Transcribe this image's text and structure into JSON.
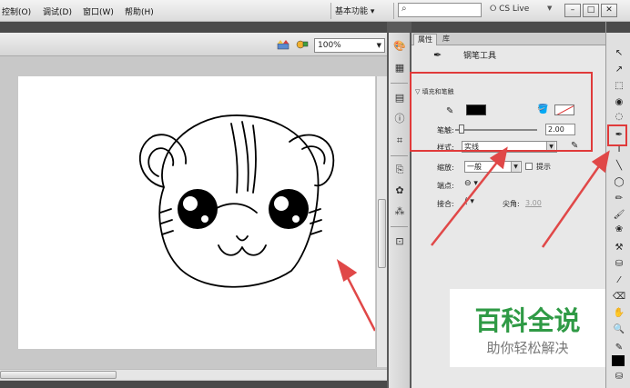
{
  "menubar": {
    "items": [
      "控制(O)",
      "调试(D)",
      "窗口(W)",
      "帮助(H)"
    ],
    "workspace": "基本功能",
    "search_placeholder": "",
    "cslive": "CS Live"
  },
  "stage": {
    "zoom": "100%"
  },
  "properties": {
    "tab_properties": "属性",
    "tab_library": "库",
    "tool_name": "钢笔工具",
    "section_fill_stroke": "填充和笔触",
    "stroke_width_label": "笔触:",
    "stroke_width_value": "2.00",
    "style_label": "样式:",
    "style_value": "实线",
    "scale_label": "缩放:",
    "scale_value": "一般",
    "hint_label": "提示",
    "cap_label": "端点:",
    "join_label": "接合:",
    "miter_label": "尖角:",
    "miter_value": "3.00",
    "colors": {
      "stroke": "#000000",
      "fill": "#ffffff",
      "highlight": "#e03a3a"
    }
  },
  "watermark": {
    "title": "百科全说",
    "subtitle": "助你轻松解决"
  },
  "icons": [
    "pen-icon",
    "pencil-icon",
    "bucket-icon",
    "search-icon",
    "minimize-icon",
    "maximize-icon",
    "close-icon",
    "arrow-tool-icon",
    "hand-tool-icon",
    "zoom-tool-icon",
    "eraser-tool-icon"
  ]
}
